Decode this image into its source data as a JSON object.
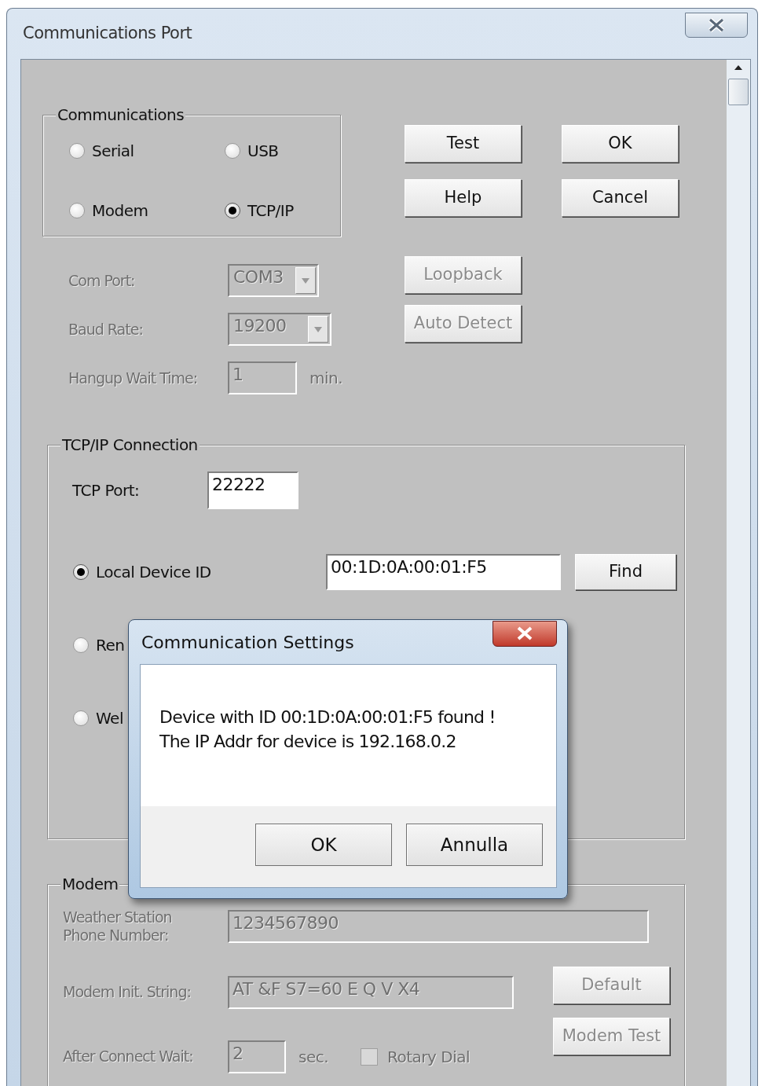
{
  "window": {
    "title": "Communications Port"
  },
  "communications": {
    "label": "Communications",
    "options": [
      {
        "label": "Serial",
        "selected": false
      },
      {
        "label": "USB",
        "selected": false
      },
      {
        "label": "Modem",
        "selected": false
      },
      {
        "label": "TCP/IP",
        "selected": true
      }
    ]
  },
  "buttons": [
    {
      "label": "Test"
    },
    {
      "label": "OK"
    },
    {
      "label": "Help"
    },
    {
      "label": "Cancel"
    }
  ],
  "serial_fields": [
    {
      "kind": "combo",
      "label": "Com Port:",
      "value": "COM3",
      "disabled": true
    },
    {
      "kind": "combo",
      "label": "Baud Rate:",
      "value": "19200",
      "disabled": true
    },
    {
      "kind": "text",
      "label": "Hangup Wait Time:",
      "value": "1",
      "unit": "min.",
      "disabled": true
    }
  ],
  "serial_buttons": [
    {
      "label": "Loopback",
      "disabled": true
    },
    {
      "label": "Auto Detect",
      "disabled": true
    }
  ],
  "tcpip": {
    "label": "TCP/IP Connection",
    "tcp_port": {
      "label": "TCP Port:",
      "value": "22222"
    },
    "modes": [
      {
        "label": "Local Device ID",
        "selected": true,
        "value": "00:1D:0A:00:01:F5",
        "button": "Find"
      },
      {
        "label": "Ren",
        "selected": false
      },
      {
        "label": "Wel",
        "selected": false
      }
    ]
  },
  "modem": {
    "label": "Modem",
    "disabled": true,
    "phone": {
      "label": "Weather Station Phone Number:",
      "value": "1234567890"
    },
    "init": {
      "label": "Modem Init. String:",
      "value": "AT &F S7=60 E Q V X4"
    },
    "wait": {
      "label": "After Connect Wait:",
      "value": "2",
      "unit": "sec."
    },
    "rotary_dial": {
      "label": "Rotary Dial",
      "checked": false
    },
    "buttons": [
      {
        "label": "Default"
      },
      {
        "label": "Modem Test"
      }
    ]
  },
  "dialog": {
    "title": "Communication Settings",
    "message": "Device with ID  00:1D:0A:00:01:F5  found !\nThe IP Addr for device is 192.168.0.2",
    "buttons": [
      "OK",
      "Annulla"
    ]
  }
}
